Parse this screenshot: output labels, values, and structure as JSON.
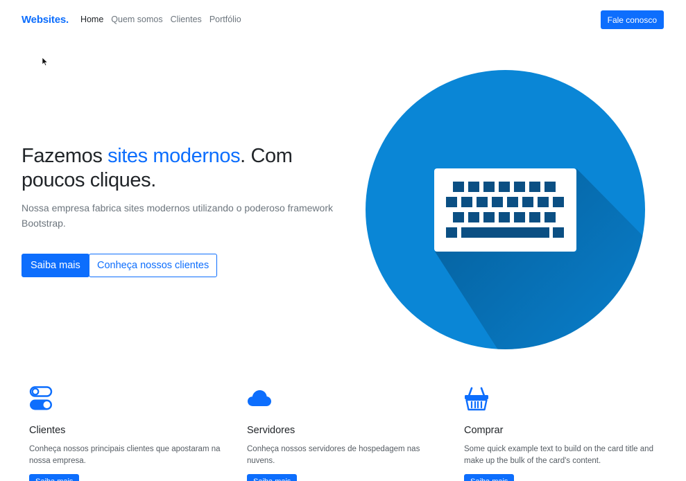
{
  "navbar": {
    "brand": "Websites.",
    "links": [
      "Home",
      "Quem somos",
      "Clientes",
      "Portfólio"
    ],
    "cta": "Fale conosco"
  },
  "hero": {
    "title_start": "Fazemos ",
    "title_accent": "sites modernos",
    "title_end": ". Com poucos cliques.",
    "lead": "Nossa empresa fabrica sites modernos utilizando o poderoso framework Bootstrap.",
    "primary_button": "Saiba mais",
    "secondary_button": "Conheça nossos clientes",
    "image_icon": "keyboard-icon"
  },
  "features": [
    {
      "icon": "toggles-icon",
      "title": "Clientes",
      "text": "Conheça nossos principais clientes que apostaram na nossa empresa.",
      "button": "Saiba mais"
    },
    {
      "icon": "cloud-icon",
      "title": "Servidores",
      "text": "Conheça nossos servidores de hospedagem nas nuvens.",
      "button": "Saiba mais"
    },
    {
      "icon": "basket-icon",
      "title": "Comprar",
      "text": "Some quick example text to build on the card title and make up the bulk of the card's content.",
      "button": "Saiba mais"
    }
  ],
  "colors": {
    "primary": "#0d6efd",
    "circle": "#0a86d6",
    "key": "#0b4f83"
  }
}
